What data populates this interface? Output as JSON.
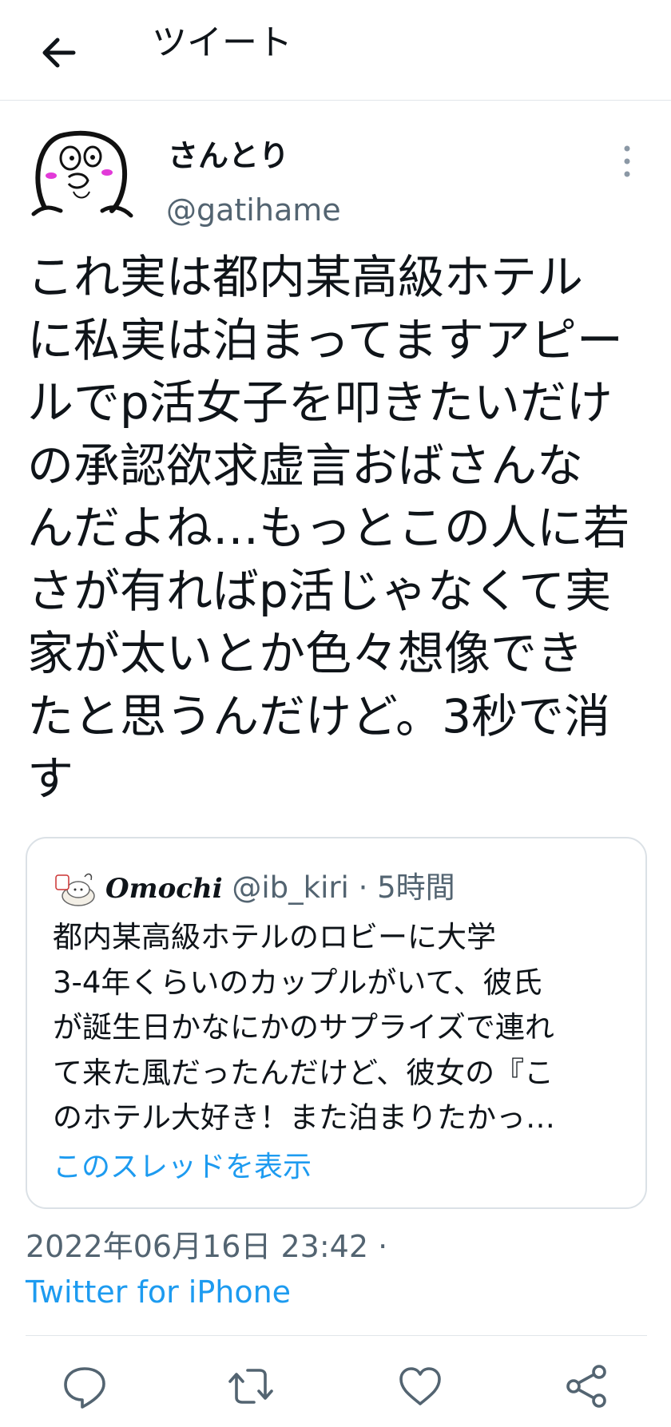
{
  "header": {
    "back_icon": "arrow-left-icon",
    "title": "ツイート"
  },
  "tweet": {
    "author": {
      "name": "さんとり",
      "handle": "@gatihame",
      "avatar_icon": "hand-drawn-face-avatar"
    },
    "more_icon": "vertical-ellipsis-icon",
    "text": "これ実は都内某高級ホテル\nに私実は泊まってますアピー\nルでp活女子を叩きたいだけ\nの承認欲求虚言おばさんな\nんだよね…もっとこの人に若\nさが有ればp活じゃなくて実\n家が太いとか色々想像でき\nたと思うんだけど。3秒で消\nす",
    "quote": {
      "name": "Omochi",
      "handle": "@ib_kiri",
      "separator": "·",
      "time": "5時間",
      "text": "都内某高級ホテルのロビーに大学\n3-4年くらいのカップルがいて、彼氏\nが誕生日かなにかのサプライズで連れ\nて来た風だったんだけど、彼女の『こ\nのホテル大好き！また泊まりたかっ…",
      "show_thread": "このスレッドを表示"
    },
    "timestamp": "2022年06月16日 23:42 ·",
    "source": "Twitter for iPhone"
  },
  "actions": [
    {
      "name": "reply",
      "icon": "reply-bubble-icon"
    },
    {
      "name": "retweet",
      "icon": "retweet-icon"
    },
    {
      "name": "like",
      "icon": "heart-icon"
    },
    {
      "name": "share",
      "icon": "share-icon"
    }
  ],
  "colors": {
    "accent": "#1d9bf0",
    "secondary_text": "#536471",
    "primary_text": "#0f1419",
    "border": "#e1e6ea"
  }
}
